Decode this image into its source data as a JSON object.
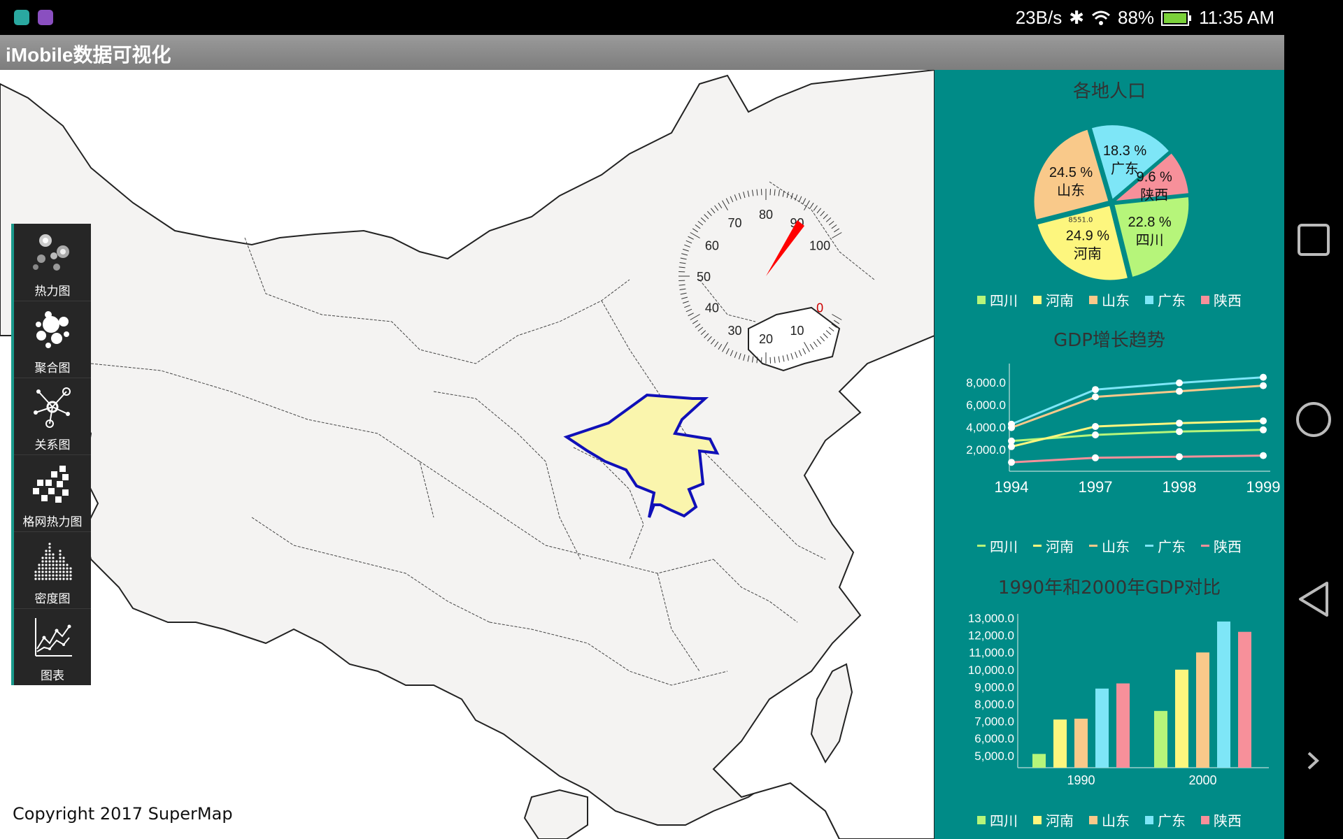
{
  "status_bar": {
    "speed": "23B/s",
    "battery": "88%",
    "time": "11:35 AM"
  },
  "app": {
    "title": "iMobile数据可视化"
  },
  "map": {
    "copyright": "Copyright 2017 SuperMap",
    "gauge_value": 0,
    "gauge_ticks": [
      "0",
      "10",
      "20",
      "30",
      "40",
      "50",
      "60",
      "70",
      "80",
      "90",
      "100"
    ]
  },
  "toolbar": {
    "items": [
      {
        "label": "热力图",
        "icon": "heatmap-icon"
      },
      {
        "label": "聚合图",
        "icon": "cluster-icon"
      },
      {
        "label": "关系图",
        "icon": "relation-icon"
      },
      {
        "label": "格网热力图",
        "icon": "grid-heatmap-icon"
      },
      {
        "label": "密度图",
        "icon": "density-icon"
      },
      {
        "label": "图表",
        "icon": "chart-icon"
      }
    ]
  },
  "colors": {
    "四川": "#b6f57a",
    "河南": "#fdf67e",
    "山东": "#f9c98a",
    "广东": "#7ee6f7",
    "陕西": "#f7909a"
  },
  "pie": {
    "title": "各地人口",
    "legend": [
      "四川",
      "河南",
      "山东",
      "广东",
      "陕西"
    ]
  },
  "line": {
    "title": "GDP增长趋势",
    "legend": [
      "四川",
      "河南",
      "山东",
      "广东",
      "陕西"
    ]
  },
  "bar": {
    "title": "1990年和2000年GDP对比",
    "legend": [
      "四川",
      "河南",
      "山东",
      "广东",
      "陕西"
    ]
  },
  "chart_data": [
    {
      "type": "pie",
      "title": "各地人口",
      "slices": [
        {
          "label": "四川",
          "pct": "22.8 %",
          "value": 22.8
        },
        {
          "label": "河南",
          "pct": "24.9 %",
          "value": 24.9,
          "note": "8551.0"
        },
        {
          "label": "山东",
          "pct": "24.5 %",
          "value": 24.5
        },
        {
          "label": "广东",
          "pct": "18.3 %",
          "value": 18.3
        },
        {
          "label": "陕西",
          "pct": "9.6 %",
          "value": 9.6
        }
      ]
    },
    {
      "type": "line",
      "title": "GDP增长趋势",
      "x": [
        "1994",
        "1997",
        "1998",
        "1999"
      ],
      "yticks": [
        "2,000.0",
        "4,000.0",
        "6,000.0",
        "8,000.0"
      ],
      "ylim": [
        0,
        9000
      ],
      "series": [
        {
          "name": "四川",
          "values": [
            2700,
            3250,
            3550,
            3700
          ]
        },
        {
          "name": "河南",
          "values": [
            2200,
            4000,
            4300,
            4500
          ]
        },
        {
          "name": "山东",
          "values": [
            3900,
            6650,
            7150,
            7650
          ]
        },
        {
          "name": "广东",
          "values": [
            4200,
            7300,
            7900,
            8400
          ]
        },
        {
          "name": "陕西",
          "values": [
            800,
            1200,
            1300,
            1400
          ]
        }
      ]
    },
    {
      "type": "bar",
      "title": "1990年和2000年GDP对比",
      "categories": [
        "1990",
        "2000"
      ],
      "yticks": [
        "5,000.0",
        "6,000.0",
        "7,000.0",
        "8,000.0",
        "9,000.0",
        "10,000.0",
        "11,000.0",
        "12,000.0",
        "13,000.0"
      ],
      "ylim": [
        4300,
        13000
      ],
      "series": [
        {
          "name": "四川",
          "values": [
            5100,
            7600
          ]
        },
        {
          "name": "河南",
          "values": [
            7100,
            10000
          ]
        },
        {
          "name": "山东",
          "values": [
            7150,
            11000
          ]
        },
        {
          "name": "广东",
          "values": [
            8900,
            12800
          ]
        },
        {
          "name": "陕西",
          "values": [
            9200,
            12200
          ]
        }
      ]
    }
  ]
}
